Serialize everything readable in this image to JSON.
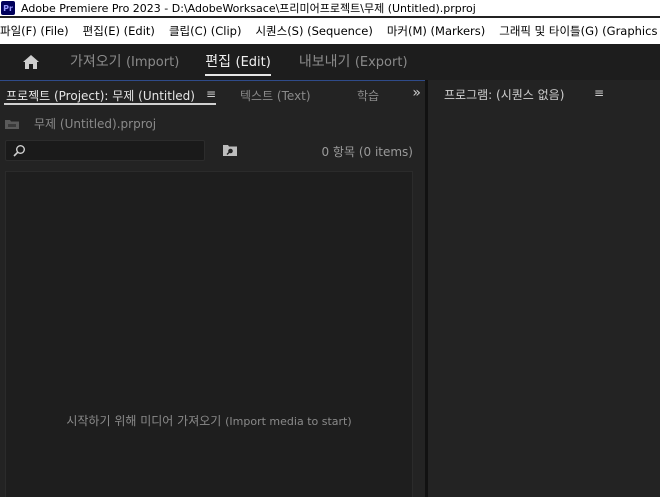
{
  "window": {
    "logo_text": "Pr",
    "title": "Adobe Premiere Pro 2023 - D:\\AdobeWorksace\\프리미어프로젝트\\무제 (Untitled).prproj"
  },
  "menu": [
    "파일(F) (File)",
    "편집(E) (Edit)",
    "클립(C) (Clip)",
    "시퀀스(S) (Sequence)",
    "마커(M) (Markers)",
    "그래픽 및 타이틀(G) (Graphics and"
  ],
  "workspace": {
    "tabs": [
      {
        "ko": "가져오기",
        "en": "(Import)"
      },
      {
        "ko": "편집",
        "en": "(Edit)"
      },
      {
        "ko": "내보내기",
        "en": "(Export)"
      }
    ]
  },
  "project_panel": {
    "tabs": [
      "프로젝트 (Project): 무제 (Untitled)",
      "텍스트 (Text)",
      "학습"
    ],
    "menu_glyph": "≡",
    "overflow_glyph": "»",
    "file_name": "무제 (Untitled).prproj",
    "item_count": "0 항목 (0 items)",
    "import_hint_ko": "시작하기 위해 미디어 가져오기",
    "import_hint_en": "(Import media to start)"
  },
  "program_panel": {
    "title": "프로그램: (시퀀스 없음)",
    "menu_glyph": "≡"
  },
  "colors": {
    "panel_bg": "#232323",
    "active_border": "#2f4b8a",
    "logo_bg": "#00005b",
    "logo_fg": "#9999ff"
  }
}
